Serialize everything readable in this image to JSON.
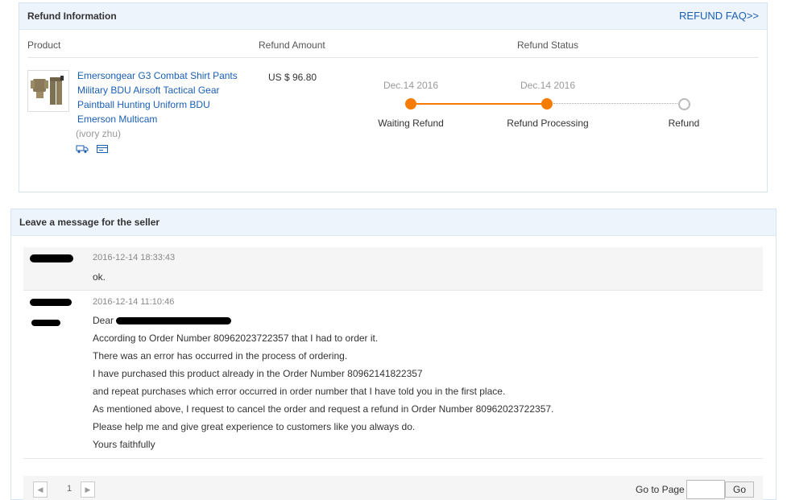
{
  "refund_info": {
    "title": "Refund Information",
    "faq_link": "REFUND FAQ>>",
    "columns": {
      "product": "Product",
      "amount": "Refund Amount",
      "status": "Refund Status"
    },
    "product": {
      "title": "Emersongear G3 Combat Shirt Pants Military BDU Airsoft Tactical Gear Paintball Hunting Uniform BDU Emerson Multicam",
      "seller": "(ivory zhu)",
      "icons": [
        "shipping-truck-icon",
        "payment-card-icon"
      ]
    },
    "amount": "US $ 96.80",
    "steps": [
      {
        "date": "Dec.14 2016",
        "label": "Waiting Refund",
        "state": "done"
      },
      {
        "date": "Dec.14 2016",
        "label": "Refund Processing",
        "state": "done"
      },
      {
        "date": "",
        "label": "Refund",
        "state": "pending"
      }
    ]
  },
  "messages": {
    "title": "Leave a message for the seller",
    "items": [
      {
        "timestamp": "2016-12-14 18:33:43",
        "lines": [
          "ok."
        ]
      },
      {
        "timestamp": "2016-12-14 11:10:46",
        "lines": [
          "Dear",
          "According to Order Number 80962023722357 that I had to order it.",
          "There was an error has occurred in the process of ordering.",
          "I have purchased this product already in the Order Number 80962141822357",
          "and repeat purchases which error occurred in order number that I have told you in the first place.",
          "As mentioned above, I request to cancel the order and request a refund in Order Number 80962023722357.",
          "Please help me and give great experience to customers like you always do.",
          "Yours faithfully"
        ]
      }
    ]
  },
  "pager": {
    "prev": "◀",
    "page": "1",
    "next": "▶",
    "goto_label": "Go to Page",
    "goto_value": "",
    "go_button": "Go"
  },
  "colors": {
    "accent": "#f57c00",
    "link": "#1a5fb4",
    "header_bg": "#eef4fb"
  }
}
